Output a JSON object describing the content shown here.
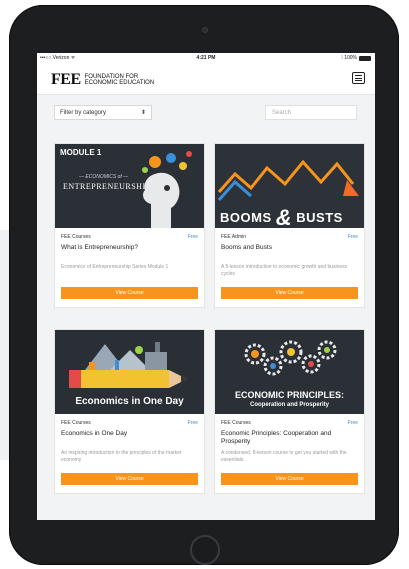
{
  "status_bar": {
    "carrier": "•••○○ Verizon ᯤ",
    "time": "4:21 PM",
    "battery": "⁞ 100%"
  },
  "header": {
    "logo_mark": "FEE",
    "logo_line1": "Foundation for",
    "logo_line2": "Economic Education",
    "menu_icon": "hamburger-menu-icon"
  },
  "filters": {
    "category_select": "Filter by category",
    "search_placeholder": "Search"
  },
  "courses": [
    {
      "image_label": "MODULE 1",
      "image_sub": "— ECONOMICS of —",
      "image_title": "ENTREPRENEURSHIP",
      "provider": "FEE Courses",
      "price": "Free",
      "title": "What is Entrepreneurship?",
      "description": "Economics of Entrepreneurship Series Module 1",
      "button": "View Course"
    },
    {
      "image_word1": "BOOMS",
      "image_amp": "&",
      "image_word2": "BUSTS",
      "provider": "FEE Admin",
      "price": "Free",
      "title": "Booms and Busts",
      "description": "A 5-lesson introduction to economic growth and business cycles",
      "button": "View Course"
    },
    {
      "image_title": "Economics in One Day",
      "provider": "FEE Courses",
      "price": "Free",
      "title": "Economics in One Day",
      "description": "An inspiring introduction to the principles of the market economy",
      "button": "View Course"
    },
    {
      "image_title1": "ECONOMIC PRINCIPLES:",
      "image_title2": "Cooperation and Prosperity",
      "provider": "FEE Courses",
      "price": "Free",
      "title": "Economic Principles: Cooperation and Prosperity",
      "description": "A condensed, 8-lesson course to get you started with the essentials.",
      "button": "View Course"
    }
  ],
  "colors": {
    "accent": "#f7941d",
    "free_badge": "#3a8fd9",
    "image_bg": "#2b2f36"
  }
}
